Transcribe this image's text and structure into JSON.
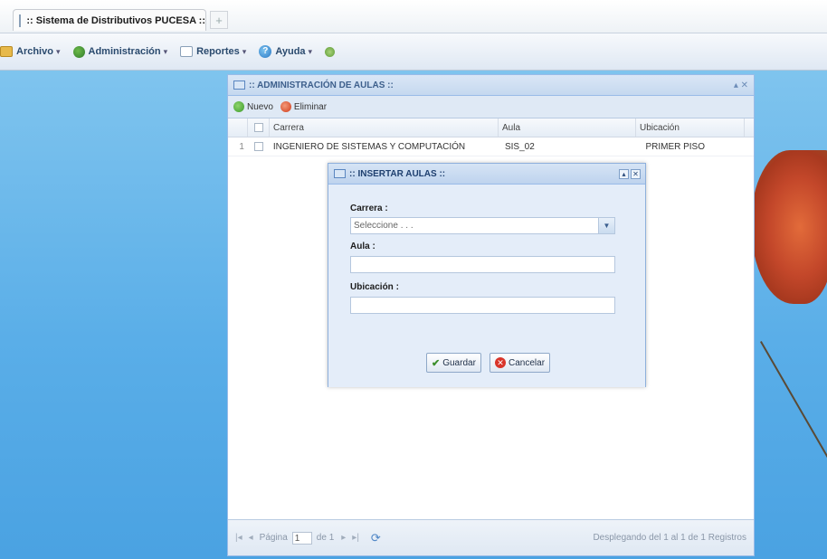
{
  "browser": {
    "tab_title": ":: Sistema de Distributivos PUCESA ::",
    "new_tab_symbol": "+"
  },
  "menu": {
    "items": [
      {
        "label": "Archivo",
        "icon": "folder-icon"
      },
      {
        "label": "Administración",
        "icon": "admin-icon"
      },
      {
        "label": "Reportes",
        "icon": "report-icon"
      },
      {
        "label": "Ayuda",
        "icon": "help-icon"
      }
    ],
    "caret": "▾"
  },
  "main_window": {
    "title": ":: ADMINISTRACIÓN DE AULAS ::",
    "tools": "▴ ✕",
    "toolbar": {
      "new_label": "Nuevo",
      "delete_label": "Eliminar"
    },
    "grid": {
      "columns": [
        "Carrera",
        "Aula",
        "Ubicación"
      ],
      "rows": [
        {
          "num": "1",
          "carrera": "INGENIERO DE SISTEMAS Y COMPUTACIÓN",
          "aula": "SIS_02",
          "ubicacion": "PRIMER PISO"
        }
      ]
    },
    "pager": {
      "page_label": "Página",
      "page_value": "1",
      "of_label": "de 1",
      "info": "Desplegando del 1 al 1 de 1 Registros"
    }
  },
  "dialog": {
    "title": ":: INSERTAR AULAS ::",
    "fields": {
      "carrera_label": "Carrera :",
      "carrera_placeholder": "Seleccione . . .",
      "aula_label": "Aula :",
      "aula_value": "",
      "ubicacion_label": "Ubicación :",
      "ubicacion_value": ""
    },
    "save_label": "Guardar",
    "cancel_label": "Cancelar"
  }
}
